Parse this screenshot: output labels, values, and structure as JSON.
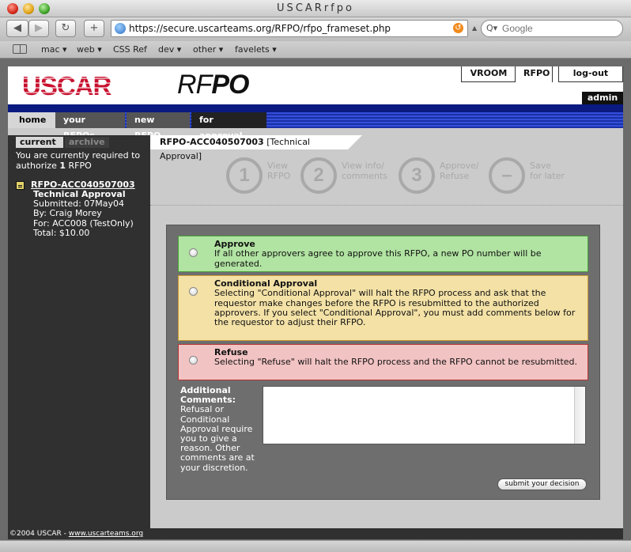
{
  "window": {
    "title": "USCARrfpo"
  },
  "toolbar": {
    "back_icon": "back-arrow-icon",
    "forward_icon": "forward-arrow-icon",
    "reload_icon": "reload-icon",
    "add_icon": "plus-icon",
    "url": "https://secure.uscarteams.org/RFPO/rfpo_frameset.php",
    "search_placeholder": "Google"
  },
  "bookmarks": {
    "items": [
      "mac ▾",
      "web ▾",
      "CSS Ref",
      "dev ▾",
      "other ▾",
      "favelets ▾"
    ]
  },
  "header": {
    "logo_main": "USCAR",
    "logo_rf": "RF",
    "logo_po": "PO",
    "top_tabs": [
      "VROOM",
      "RFPO",
      "log-out"
    ],
    "user_badge": "admin"
  },
  "nav": {
    "tabs": [
      "home",
      "your RFPOs",
      "new RFPO",
      "for approval"
    ]
  },
  "sidebar": {
    "tabs": [
      "current",
      "archive"
    ],
    "note_line1": "You are currently required to",
    "note_line2_prefix": "authorize ",
    "note_line2_count": "1",
    "note_line2_suffix": " RFPO",
    "item": {
      "link": "RFPO-ACC040507003",
      "type": "Technical Approval",
      "submitted": "Submitted: 07May04",
      "by": "By: Craig Morey",
      "for": "For: ACC008 (TestOnly)",
      "total": "Total: $10.00"
    }
  },
  "main": {
    "context_id": "RFPO-ACC040507003",
    "context_stage": "[Technical Approval]",
    "steps": [
      {
        "num": "1",
        "line1": "View",
        "line2": "RFPO"
      },
      {
        "num": "2",
        "line1": "View info/",
        "line2": "comments"
      },
      {
        "num": "3",
        "line1": "Approve/",
        "line2": "Refuse"
      },
      {
        "num": "–",
        "line1": "Save",
        "line2": "for later"
      }
    ],
    "options": {
      "approve": {
        "title": "Approve",
        "text": "If all other approvers agree to approve this RFPO, a new PO number will be generated."
      },
      "conditional": {
        "title": "Conditional Approval",
        "text": "Selecting \"Conditional Approval\" will halt the RFPO process and ask that the requestor make changes before the RFPO is resubmitted to the authorized approvers. If you select \"Conditional Approval\", you must add comments below for the requestor to adjust their RFPO."
      },
      "refuse": {
        "title": "Refuse",
        "text": "Selecting \"Refuse\" will halt the RFPO process and the RFPO cannot be resubmitted."
      }
    },
    "comments_title": "Additional Comments:",
    "comments_help": "Refusal or Conditional Approval require you to give a reason. Other comments are at your discretion.",
    "comments_value": "",
    "submit_label": "submit your decision"
  },
  "footer": {
    "copyright": "©2004 USCAR - ",
    "link": "www.uscarteams.org"
  },
  "colors": {
    "approve_bg": "#b1e3a2",
    "conditional_bg": "#f3e1a6",
    "refuse_bg": "#f2c3c3",
    "brand_red": "#c8102e",
    "brand_blue": "#0b2a8c"
  }
}
